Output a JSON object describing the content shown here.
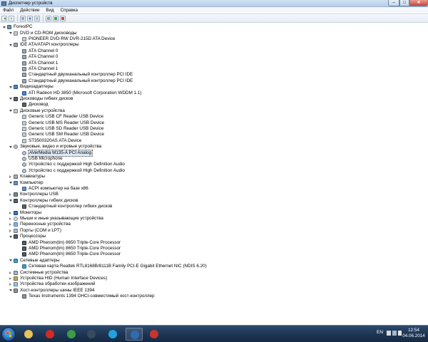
{
  "window": {
    "title": "Диспетчер устройств",
    "buttons": {
      "minimize": "–",
      "maximize": "□",
      "close": "✕"
    }
  },
  "menu": [
    "Файл",
    "Действие",
    "Вид",
    "Справка"
  ],
  "toolbar": {
    "icons": [
      "back-icon",
      "forward-icon",
      "properties-icon",
      "help-icon",
      "update-driver-icon",
      "scan-hardware-icon",
      "disable-icon",
      "uninstall-icon"
    ]
  },
  "tree": [
    {
      "level": 0,
      "state": "open",
      "icon": "computer",
      "label": "ForestPC"
    },
    {
      "level": 1,
      "state": "open",
      "icon": "disk",
      "label": "DVD и CD-ROM дисководы"
    },
    {
      "level": 2,
      "state": "none",
      "icon": "disk",
      "label": "PIONEER DVD-RW  DVR-215D ATA Device"
    },
    {
      "level": 1,
      "state": "open",
      "icon": "ide",
      "label": "IDE ATA/ATAPI контроллеры"
    },
    {
      "level": 2,
      "state": "none",
      "icon": "ide",
      "label": "ATA Channel 0"
    },
    {
      "level": 2,
      "state": "none",
      "icon": "ide",
      "label": "ATA Channel 0"
    },
    {
      "level": 2,
      "state": "none",
      "icon": "ide",
      "label": "ATA Channel 1"
    },
    {
      "level": 2,
      "state": "none",
      "icon": "ide",
      "label": "ATA Channel 1"
    },
    {
      "level": 2,
      "state": "none",
      "icon": "ide",
      "label": "Стандартный двухканальный контроллер PCI IDE"
    },
    {
      "level": 2,
      "state": "none",
      "icon": "ide",
      "label": "Стандартный двухканальный контроллер PCI IDE"
    },
    {
      "level": 1,
      "state": "open",
      "icon": "video",
      "label": "Видеоадаптеры"
    },
    {
      "level": 2,
      "state": "none",
      "icon": "video",
      "label": "ATI Radeon HD 3850 (Microsoft Corporation WDDM 1.1)"
    },
    {
      "level": 1,
      "state": "open",
      "icon": "floppy",
      "label": "Дисководы гибких дисков"
    },
    {
      "level": 2,
      "state": "none",
      "icon": "floppy",
      "label": "Дисковод"
    },
    {
      "level": 1,
      "state": "open",
      "icon": "disk",
      "label": "Дисковые устройства"
    },
    {
      "level": 2,
      "state": "none",
      "icon": "disk",
      "label": "Generic USB CF Reader USB Device"
    },
    {
      "level": 2,
      "state": "none",
      "icon": "disk",
      "label": "Generic USB MS Reader USB Device"
    },
    {
      "level": 2,
      "state": "none",
      "icon": "disk",
      "label": "Generic USB SD Reader USB Device"
    },
    {
      "level": 2,
      "state": "none",
      "icon": "disk",
      "label": "Generic USB SM Reader USB Device"
    },
    {
      "level": 2,
      "state": "none",
      "icon": "disk",
      "label": "ST3500320AS ATA Device"
    },
    {
      "level": 1,
      "state": "open",
      "icon": "sound",
      "label": "Звуковые, видео и игровые устройства"
    },
    {
      "level": 2,
      "state": "none",
      "icon": "sound",
      "label": "AVerMedia M135-A PCI Analog",
      "selected": true
    },
    {
      "level": 2,
      "state": "none",
      "icon": "sound",
      "label": "USB Microphone"
    },
    {
      "level": 2,
      "state": "none",
      "icon": "sound",
      "label": "Устройство с поддержкой High Definition Audio"
    },
    {
      "level": 2,
      "state": "none",
      "icon": "sound",
      "label": "Устройство с поддержкой High Definition Audio"
    },
    {
      "level": 1,
      "state": "closed",
      "icon": "keyboard",
      "label": "Клавиатуры"
    },
    {
      "level": 1,
      "state": "open",
      "icon": "computer",
      "label": "Компьютер"
    },
    {
      "level": 2,
      "state": "none",
      "icon": "computer",
      "label": "ACPI компьютер на базе x86"
    },
    {
      "level": 1,
      "state": "closed",
      "icon": "usb",
      "label": "Контроллеры USB"
    },
    {
      "level": 1,
      "state": "open",
      "icon": "floppy",
      "label": "Контроллеры гибких дисков"
    },
    {
      "level": 2,
      "state": "none",
      "icon": "floppy",
      "label": "Стандартный контроллер гибких дисков"
    },
    {
      "level": 1,
      "state": "closed",
      "icon": "monitor",
      "label": "Мониторы"
    },
    {
      "level": 1,
      "state": "closed",
      "icon": "mouse",
      "label": "Мыши и иные указывающие устройства"
    },
    {
      "level": 1,
      "state": "closed",
      "icon": "portable",
      "label": "Переносные устройства"
    },
    {
      "level": 1,
      "state": "closed",
      "icon": "port",
      "label": "Порты (COM и LPT)"
    },
    {
      "level": 1,
      "state": "open",
      "icon": "cpu",
      "label": "Процессоры"
    },
    {
      "level": 2,
      "state": "none",
      "icon": "cpu",
      "label": "AMD Phenom(tm) 8650 Triple-Core Processor"
    },
    {
      "level": 2,
      "state": "none",
      "icon": "cpu",
      "label": "AMD Phenom(tm) 8650 Triple-Core Processor"
    },
    {
      "level": 2,
      "state": "none",
      "icon": "cpu",
      "label": "AMD Phenom(tm) 8650 Triple-Core Processor"
    },
    {
      "level": 1,
      "state": "open",
      "icon": "net",
      "label": "Сетевые адаптеры"
    },
    {
      "level": 2,
      "state": "none",
      "icon": "net",
      "label": "Сетевая карта Realtek RTL8168B/8111B Family PCI-E Gigabit Ethernet NIC (NDIS 6.20)"
    },
    {
      "level": 1,
      "state": "closed",
      "icon": "system",
      "label": "Системные устройства"
    },
    {
      "level": 1,
      "state": "closed",
      "icon": "hid",
      "label": "Устройства HID (Human Interface Devices)"
    },
    {
      "level": 1,
      "state": "closed",
      "icon": "image",
      "label": "Устройства обработки изображений"
    },
    {
      "level": 1,
      "state": "open",
      "icon": "1394",
      "label": "Хост-контроллеры шины IEEE 1394"
    },
    {
      "level": 2,
      "state": "none",
      "icon": "1394",
      "label": "Texas Instruments 1394 OHCI-совместимый хост-контроллер"
    }
  ],
  "taskbar": {
    "apps": [
      {
        "name": "explorer-icon",
        "color": "#e9c25a"
      },
      {
        "name": "opera-icon",
        "color": "#d22a24"
      },
      {
        "name": "chrome-icon",
        "color": "#3f9b46"
      },
      {
        "name": "steam-icon",
        "color": "#3a4a5e"
      },
      {
        "name": "skype-icon",
        "color": "#1fa3e0"
      },
      {
        "name": "display-icon",
        "color": "#2f6cb3"
      },
      {
        "name": "toolbox-icon",
        "color": "#c8342c"
      }
    ],
    "language": "EN",
    "time": "12:54",
    "date": "04.06.2014"
  }
}
